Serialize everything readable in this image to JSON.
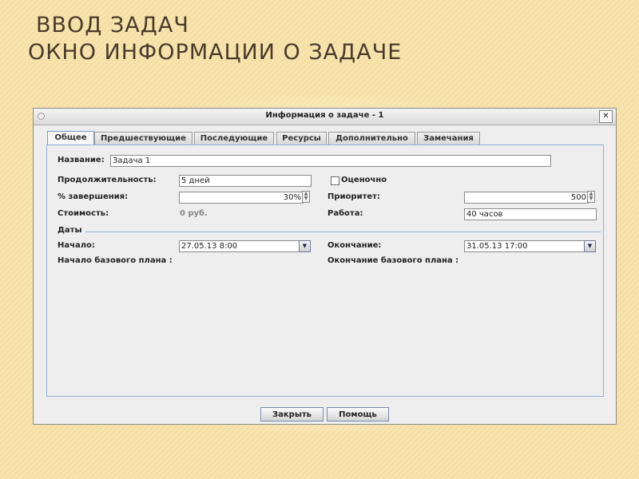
{
  "slide": {
    "title_line1": "ВВОД ЗАДАЧ",
    "title_line2": "ОКНО ИНФОРМАЦИИ О ЗАДАЧЕ"
  },
  "window": {
    "title": "Информация о задаче - 1",
    "close_glyph": "✕"
  },
  "tabs": [
    {
      "label": "Общее",
      "active": true
    },
    {
      "label": "Предшествующие"
    },
    {
      "label": "Последующие"
    },
    {
      "label": "Ресурсы"
    },
    {
      "label": "Дополнительно"
    },
    {
      "label": "Замечания"
    }
  ],
  "form": {
    "name_label": "Название:",
    "name_value": "Задача 1",
    "duration_label": "Продолжительность:",
    "duration_value": "5 дней",
    "estimated_label": "Оценочно",
    "estimated_checked": false,
    "percent_label": "% завершения:",
    "percent_value": "30%",
    "priority_label": "Приоритет:",
    "priority_value": "500",
    "cost_label": "Стоимость:",
    "cost_value": "0 руб.",
    "work_label": "Работа:",
    "work_value": "40 часов",
    "dates_section_label": "Даты",
    "start_label": "Начало:",
    "start_value": "27.05.13 8:00",
    "finish_label": "Окончание:",
    "finish_value": "31.05.13 17:00",
    "baseline_start_label": "Начало базового плана :",
    "baseline_finish_label": "Окончание базового плана :"
  },
  "buttons": {
    "close_label": "Закрыть",
    "help_label": "Помощь"
  },
  "icons": {
    "spin_up": "▲",
    "spin_down": "▼",
    "combo_arrow": "▼"
  }
}
